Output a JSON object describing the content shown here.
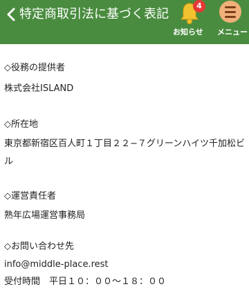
{
  "header": {
    "title": "特定商取引法に基づく表記",
    "notice_label": "お知らせ",
    "notice_badge": "4",
    "menu_label": "メニュー",
    "colors": {
      "bar": "#4a8c3f",
      "badge": "#e53935",
      "bell": "#f2c230",
      "menu_circle": "#f0b07a"
    }
  },
  "sections": {
    "provider": {
      "heading": "◇役務の提供者",
      "value": "株式会社ISLAND"
    },
    "address": {
      "heading": "◇所在地",
      "value": "東京都新宿区百人町１丁目２２−７グリーンハイツ千加松ビル"
    },
    "manager": {
      "heading": "◇運営責任者",
      "value": "熟年広場運営事務局"
    },
    "contact": {
      "heading": "◇お問い合わせ先",
      "email": "info@middle-place.rest",
      "hours": "受付時間　平日１０：００〜１８：００"
    }
  }
}
